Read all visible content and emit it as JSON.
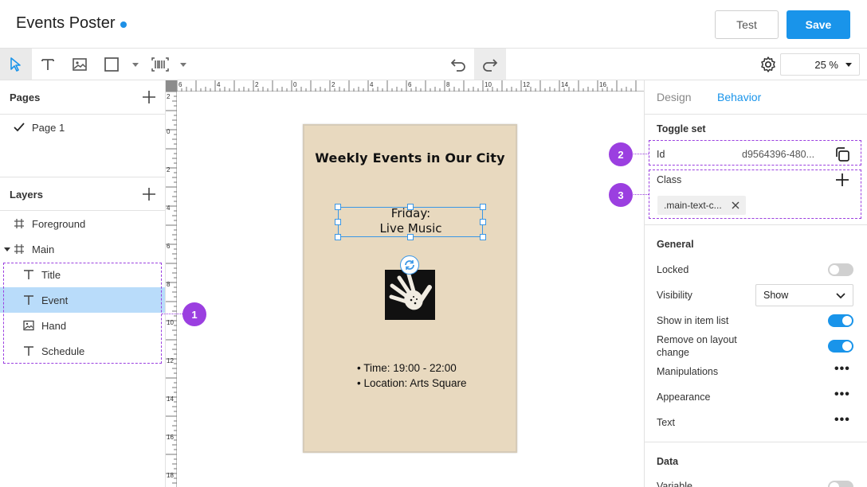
{
  "header": {
    "title": "Events Poster",
    "test_label": "Test",
    "save_label": "Save"
  },
  "toolbar": {
    "zoom": "25 %",
    "tools": [
      "select-tool",
      "text-tool",
      "image-tool",
      "shape-tool",
      "barcode-tool"
    ]
  },
  "pages": {
    "title": "Pages",
    "items": [
      {
        "label": "Page 1"
      }
    ]
  },
  "layers": {
    "title": "Layers",
    "items": [
      {
        "label": "Foreground"
      },
      {
        "label": "Main"
      },
      {
        "label": "Title"
      },
      {
        "label": "Event"
      },
      {
        "label": "Hand"
      },
      {
        "label": "Schedule"
      }
    ]
  },
  "ruler": {
    "top": [
      "6",
      "4",
      "2",
      "0",
      "2",
      "4",
      "6",
      "8",
      "10",
      "12",
      "14",
      "16"
    ],
    "left": [
      "2",
      "0",
      "2",
      "4",
      "6",
      "8",
      "10",
      "12",
      "14",
      "16",
      "18"
    ]
  },
  "poster": {
    "title": "Weekly Events in Our City",
    "event_line1": "Friday:",
    "event_line2": "Live Music",
    "schedule": [
      "• Time: 19:00 - 22:00",
      "• Location: Arts Square"
    ]
  },
  "inspector": {
    "tabs": [
      "Design",
      "Behavior"
    ],
    "active_tab": "Behavior",
    "toggle_set_title": "Toggle set",
    "id_label": "Id",
    "id_value": "d9564396-480...",
    "class_label": "Class",
    "class_chip": ".main-text-c...",
    "general_title": "General",
    "locked_label": "Locked",
    "locked": false,
    "visibility_label": "Visibility",
    "visibility_value": "Show",
    "show_in_list_label": "Show in item list",
    "show_in_list": true,
    "remove_on_layout_label_1": "Remove on layout",
    "remove_on_layout_label_2": "change",
    "remove_on_layout": true,
    "manipulations_label": "Manipulations",
    "appearance_label": "Appearance",
    "text_label": "Text",
    "data_title": "Data",
    "variable_label": "Variable"
  },
  "callouts": [
    "1",
    "2",
    "3"
  ],
  "colors": {
    "accent": "#1994ea",
    "selected_row": "#b9dcfa",
    "callout": "#9b3fe0",
    "poster_bg": "#e8d9bf"
  }
}
